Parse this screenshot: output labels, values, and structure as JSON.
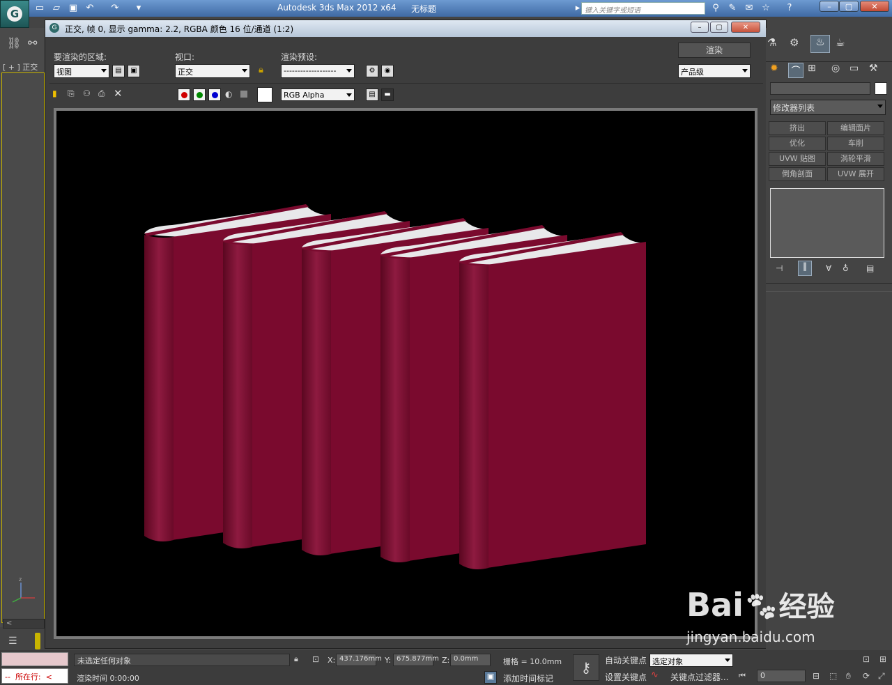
{
  "app": {
    "title": "Autodesk 3ds Max  2012 x64",
    "document": "无标题",
    "search_placeholder": "键入关键字或短语"
  },
  "viewport": {
    "label": "[ + ] 正交"
  },
  "render_window": {
    "title": "正交, 帧 0, 显示 gamma: 2.2, RGBA 颜色 16 位/通道 (1:2)",
    "area_label": "要渲染的区域:",
    "area_value": "视图",
    "viewport_label": "视口:",
    "viewport_value": "正交",
    "preset_label": "渲染预设:",
    "preset_value": "-------------------",
    "render_button": "渲染",
    "quality_value": "产品级",
    "channel_value": "RGB Alpha",
    "book_color": "#7a0a2e"
  },
  "command_panel": {
    "modifier_list": "修改器列表",
    "buttons": [
      "挤出",
      "编辑面片",
      "优化",
      "车削",
      "UVW 贴图",
      "涡轮平滑",
      "倒角剖面",
      "UVW 展开"
    ]
  },
  "status": {
    "selection": "未选定任何对象",
    "render_time": "渲染时间  0:00:00",
    "in_progress": "所在行:",
    "x_label": "X:",
    "x_value": "437.176mm",
    "y_label": "Y:",
    "y_value": "675.877mm",
    "z_label": "Z:",
    "z_value": "0.0mm",
    "grid": "栅格 = 10.0mm",
    "add_time_tag": "添加时间标记",
    "auto_key": "自动关键点",
    "set_key": "设置关键点",
    "selected_object": "选定对象",
    "key_filter": "关键点过滤器...",
    "frame_value": "0"
  },
  "watermark": {
    "brand": "Bai",
    "brand_cn": "经验",
    "url": "jingyan.baidu.com"
  }
}
